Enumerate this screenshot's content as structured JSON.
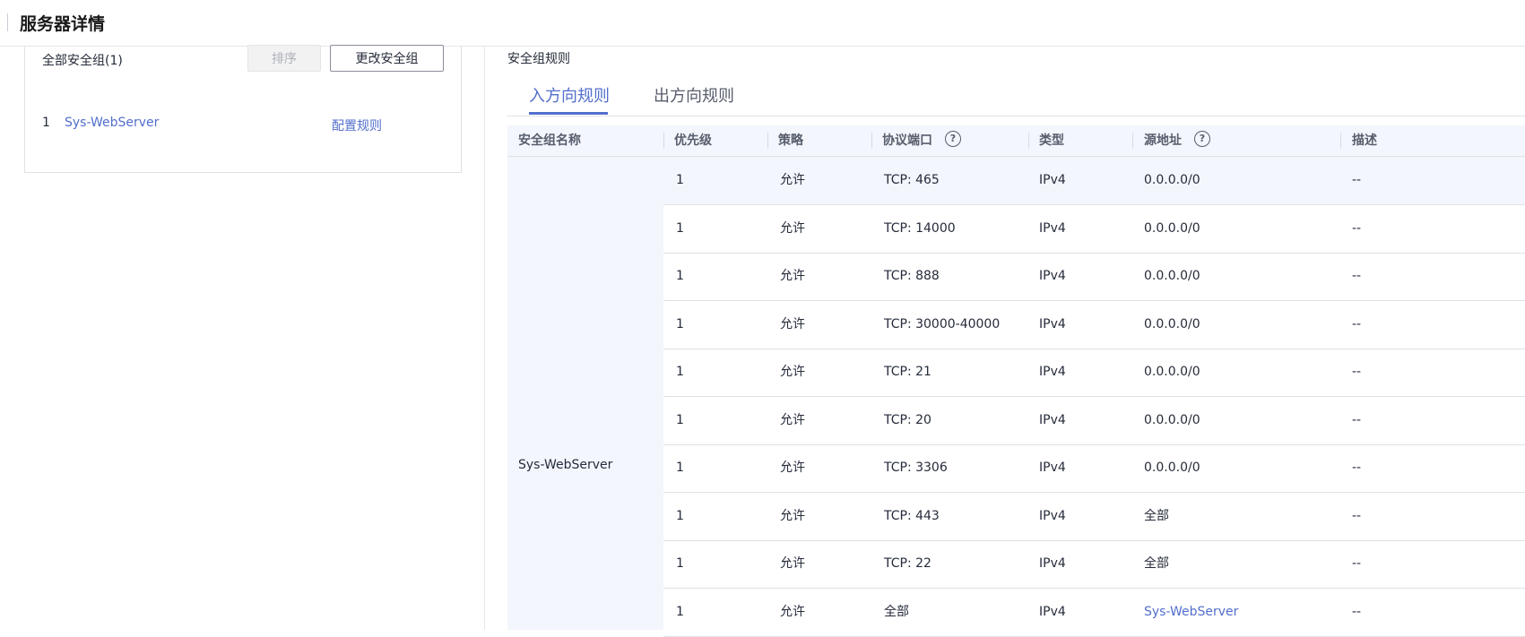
{
  "header": {
    "title": "服务器详情"
  },
  "left_panel": {
    "all_groups_label": "全部安全组(1)",
    "sort_button": "排序",
    "change_button": "更改安全组",
    "groups": [
      {
        "index": "1",
        "name": "Sys-WebServer",
        "config_link": "配置规则"
      }
    ]
  },
  "rules_panel": {
    "section_label": "安全组规则",
    "tabs": [
      {
        "label": "入方向规则",
        "active": true
      },
      {
        "label": "出方向规则",
        "active": false
      }
    ],
    "columns": [
      "安全组名称",
      "优先级",
      "策略",
      "协议端口",
      "类型",
      "源地址",
      "描述"
    ],
    "group_name": "Sys-WebServer",
    "rows": [
      {
        "priority": "1",
        "policy": "允许",
        "port": "TCP: 465",
        "type": "IPv4",
        "source": "0.0.0.0/0",
        "desc": "--"
      },
      {
        "priority": "1",
        "policy": "允许",
        "port": "TCP: 14000",
        "type": "IPv4",
        "source": "0.0.0.0/0",
        "desc": "--"
      },
      {
        "priority": "1",
        "policy": "允许",
        "port": "TCP: 888",
        "type": "IPv4",
        "source": "0.0.0.0/0",
        "desc": "--"
      },
      {
        "priority": "1",
        "policy": "允许",
        "port": "TCP: 30000-40000",
        "type": "IPv4",
        "source": "0.0.0.0/0",
        "desc": "--"
      },
      {
        "priority": "1",
        "policy": "允许",
        "port": "TCP: 21",
        "type": "IPv4",
        "source": "0.0.0.0/0",
        "desc": "--"
      },
      {
        "priority": "1",
        "policy": "允许",
        "port": "TCP: 20",
        "type": "IPv4",
        "source": "0.0.0.0/0",
        "desc": "--"
      },
      {
        "priority": "1",
        "policy": "允许",
        "port": "TCP: 3306",
        "type": "IPv4",
        "source": "0.0.0.0/0",
        "desc": "--"
      },
      {
        "priority": "1",
        "policy": "允许",
        "port": "TCP: 443",
        "type": "IPv4",
        "source": "全部",
        "desc": "--"
      },
      {
        "priority": "1",
        "policy": "允许",
        "port": "TCP: 22",
        "type": "IPv4",
        "source": "全部",
        "desc": "--"
      },
      {
        "priority": "1",
        "policy": "允许",
        "port": "全部",
        "type": "IPv4",
        "source": "Sys-WebServer",
        "source_is_link": true,
        "desc": "--"
      }
    ]
  },
  "colors": {
    "link": "#526ecc",
    "header_bg": "#f3f6fc",
    "border": "#dfe1e6"
  }
}
